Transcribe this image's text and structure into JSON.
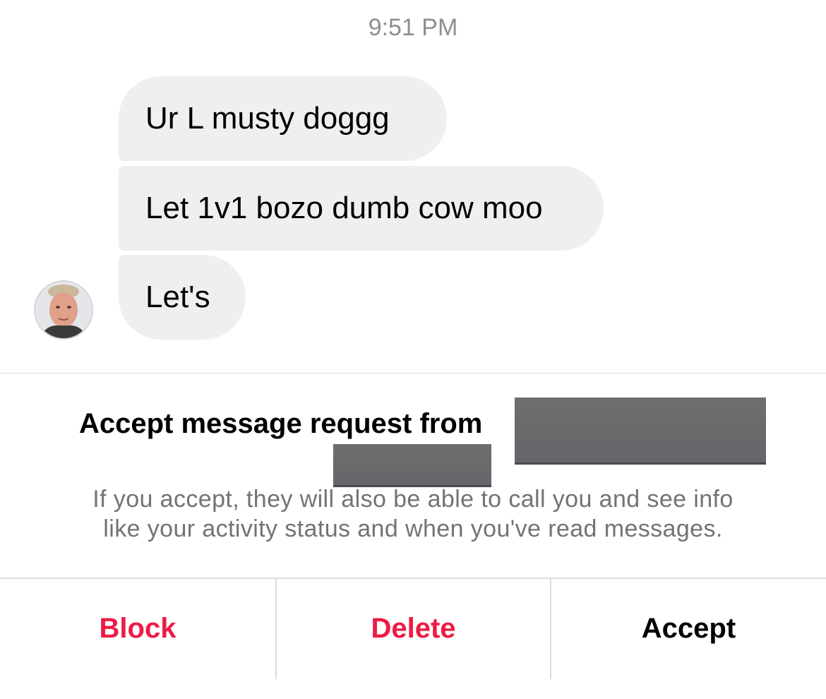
{
  "thread": {
    "timestamp": "9:51 PM",
    "messages": [
      {
        "text": "Ur L musty doggg"
      },
      {
        "text": "Let 1v1 bozo dumb cow moo"
      },
      {
        "text": "Let's"
      }
    ],
    "sender_avatar_icon": "user-photo"
  },
  "request": {
    "title": "Accept message request from",
    "description_line1": "If you accept, they will also be able to call you and see info",
    "description_line2": "like your activity status and when you've read messages."
  },
  "actions": {
    "block_label": "Block",
    "delete_label": "Delete",
    "accept_label": "Accept"
  },
  "colors": {
    "bubble": "#efefef",
    "destructive": "#ed1b45",
    "secondary_text": "#737373",
    "divider": "#dbdbdb"
  }
}
